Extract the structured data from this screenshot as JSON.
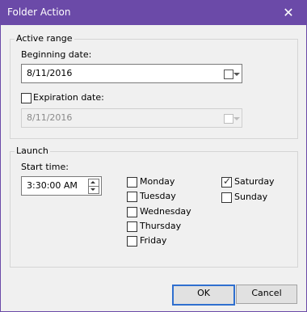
{
  "window": {
    "title": "Folder Action",
    "close_glyph": "✕"
  },
  "active_range": {
    "group_label": "Active range",
    "beginning_label": "Beginning date:",
    "beginning_value": "8/11/2016",
    "expiration_label": "Expiration date:",
    "expiration_checked": false,
    "expiration_value": "8/11/2016"
  },
  "launch": {
    "group_label": "Launch",
    "start_time_label": "Start time:",
    "start_time_value": "3:30:00 AM",
    "days": [
      {
        "label": "Monday",
        "checked": false
      },
      {
        "label": "Tuesday",
        "checked": false
      },
      {
        "label": "Wednesday",
        "checked": false
      },
      {
        "label": "Thursday",
        "checked": false
      },
      {
        "label": "Friday",
        "checked": false
      },
      {
        "label": "Saturday",
        "checked": true
      },
      {
        "label": "Sunday",
        "checked": false
      }
    ],
    "check_glyph": "✓"
  },
  "buttons": {
    "ok": "OK",
    "cancel": "Cancel"
  },
  "colors": {
    "titlebar": "#6b4aa8",
    "default_button_border": "#2f6fcf"
  }
}
